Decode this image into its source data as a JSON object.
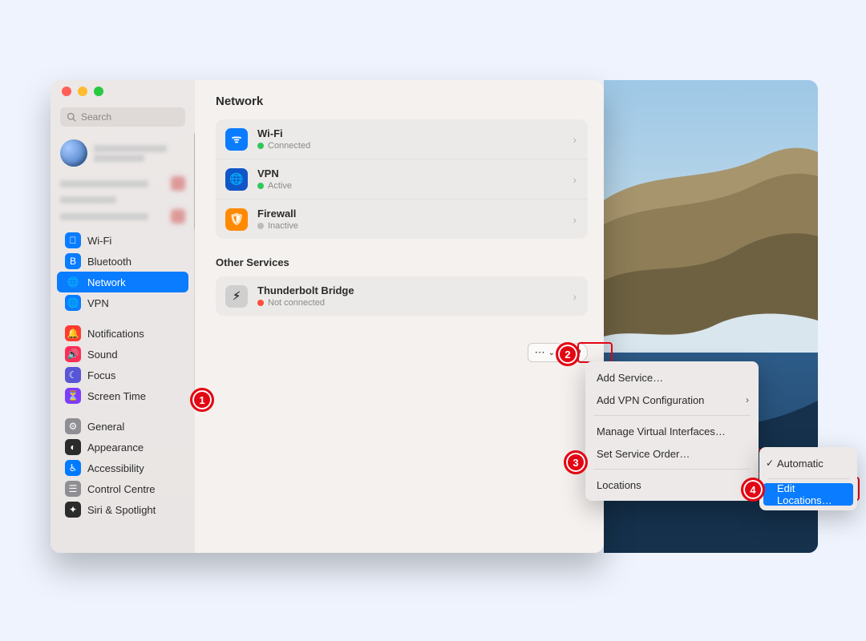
{
  "window": {
    "search_placeholder": "Search"
  },
  "sidebar": {
    "items": [
      {
        "icon": "wifi-icon",
        "label": "Wi-Fi",
        "selected": false,
        "icon_bg": "ic-blue"
      },
      {
        "icon": "bluetooth-icon",
        "label": "Bluetooth",
        "selected": false,
        "icon_bg": "ic-blue"
      },
      {
        "icon": "globe-icon",
        "label": "Network",
        "selected": true,
        "icon_bg": "ic-blue"
      },
      {
        "icon": "vpn-icon",
        "label": "VPN",
        "selected": false,
        "icon_bg": "ic-blue"
      },
      {
        "icon": "bell-icon",
        "label": "Notifications",
        "selected": false,
        "icon_bg": "ic-red"
      },
      {
        "icon": "speaker-icon",
        "label": "Sound",
        "selected": false,
        "icon_bg": "ic-pink"
      },
      {
        "icon": "moon-icon",
        "label": "Focus",
        "selected": false,
        "icon_bg": "ic-purple"
      },
      {
        "icon": "hourglass-icon",
        "label": "Screen Time",
        "selected": false,
        "icon_bg": "ic-violet"
      },
      {
        "icon": "gear-icon",
        "label": "General",
        "selected": false,
        "icon_bg": "ic-slate"
      },
      {
        "icon": "appearance-icon",
        "label": "Appearance",
        "selected": false,
        "icon_bg": "ic-black"
      },
      {
        "icon": "accessibility-icon",
        "label": "Accessibility",
        "selected": false,
        "icon_bg": "ic-teal"
      },
      {
        "icon": "controlcentre-icon",
        "label": "Control Centre",
        "selected": false,
        "icon_bg": "ic-slate"
      },
      {
        "icon": "siri-icon",
        "label": "Siri & Spotlight",
        "selected": false,
        "icon_bg": "ic-black"
      }
    ],
    "group_breaks": [
      4,
      8
    ]
  },
  "main": {
    "title": "Network",
    "services": [
      {
        "icon": "wifi-icon",
        "icon_bg": "ic-blue",
        "name": "Wi-Fi",
        "status": "Connected",
        "dot": "green-dot"
      },
      {
        "icon": "globe-icon",
        "icon_bg": "ic-darkblue",
        "name": "VPN",
        "status": "Active",
        "dot": "green-dot"
      },
      {
        "icon": "shield-icon",
        "icon_bg": "ic-orange",
        "name": "Firewall",
        "status": "Inactive",
        "dot": "gray-dot"
      }
    ],
    "other_label": "Other Services",
    "other_services": [
      {
        "icon": "bolt-icon",
        "icon_bg": "ic-gray",
        "name": "Thunderbolt Bridge",
        "status": "Not connected",
        "dot": "red-dot"
      }
    ],
    "more_button": "⋯",
    "help_button": "?"
  },
  "menu": {
    "items": [
      {
        "label": "Add Service…",
        "submenu": false
      },
      {
        "label": "Add VPN Configuration",
        "submenu": true
      },
      {
        "sep": true
      },
      {
        "label": "Manage Virtual Interfaces…",
        "submenu": false
      },
      {
        "label": "Set Service Order…",
        "submenu": false
      },
      {
        "sep": true
      },
      {
        "label": "Locations",
        "submenu": true,
        "highlight_box": true
      }
    ]
  },
  "submenu": {
    "items": [
      {
        "label": "Automatic",
        "checked": true,
        "highlight": false
      },
      {
        "sep": true
      },
      {
        "label": "Edit Locations…",
        "checked": false,
        "highlight": true
      }
    ]
  },
  "callouts": {
    "1": "1",
    "2": "2",
    "3": "3",
    "4": "4"
  }
}
